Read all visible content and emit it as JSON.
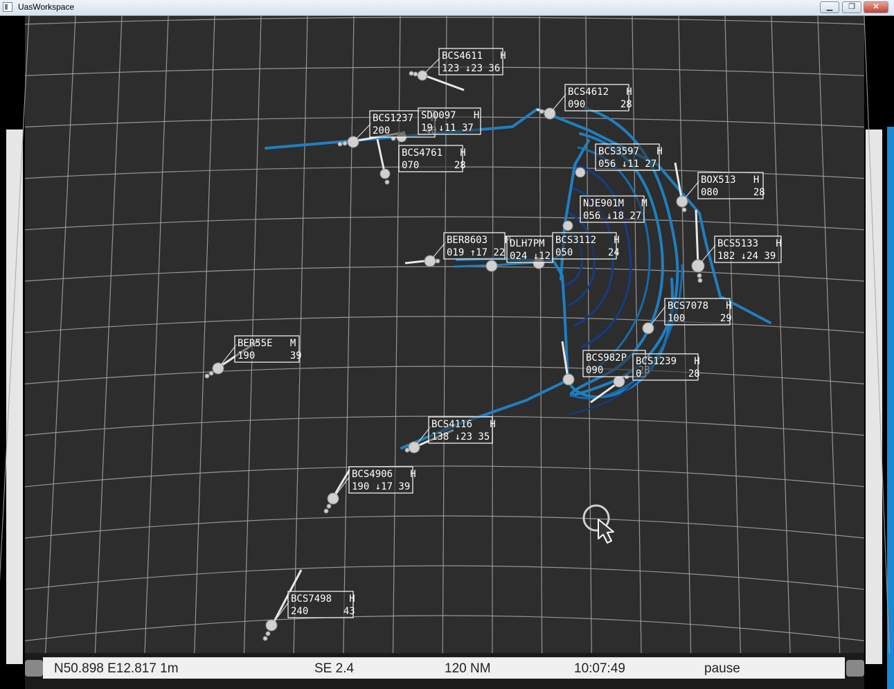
{
  "window": {
    "title": "UasWorkspace",
    "minimize_label": "▁",
    "restore_label": "❐",
    "close_label": "✕"
  },
  "status": {
    "position": "N50.898  E12.817  1m",
    "wind": "SE 2.4",
    "range": "120 NM",
    "time": "10:07:49",
    "mode": "pause"
  },
  "colors": {
    "background": "#2d2d2d",
    "grid": "#a8a8a8",
    "route_light": "#1f7fbf",
    "route_dark": "#143c86",
    "label_border": "#ffffff"
  },
  "icons": [
    "cursor-arrow-icon",
    "minimize-icon",
    "restore-icon",
    "close-icon"
  ],
  "aircraft": [
    {
      "id": "bcs4611",
      "line1": "BCS4611   H",
      "line2": "123 ↓23 36"
    },
    {
      "id": "bcs4612",
      "line1": "BCS4612   H",
      "line2": "090      28"
    },
    {
      "id": "bcs1237",
      "line1": "BCS1237   H",
      "line2": "200      40"
    },
    {
      "id": "sdo097",
      "line1": "SDO097   H",
      "line2": "19 ↓11 37"
    },
    {
      "id": "bcs4761",
      "line1": "BCS4761   H",
      "line2": "070      28"
    },
    {
      "id": "bcs3597",
      "line1": "BCS3597   H",
      "line2": "056 ↓11 27"
    },
    {
      "id": "box513",
      "line1": "BOX513   H",
      "line2": "080      28"
    },
    {
      "id": "nje901m",
      "line1": "NJE901M   M",
      "line2": "056 ↓18 27"
    },
    {
      "id": "ber8603",
      "line1": "BER8603   M",
      "line2": "019 ↑17 22"
    },
    {
      "id": "dlh7pm",
      "line1": "DLH7PM",
      "line2": "024 ↓12"
    },
    {
      "id": "bcs3112",
      "line1": "BCS3112   H",
      "line2": "050      24"
    },
    {
      "id": "bcs5133",
      "line1": "BCS5133   H",
      "line2": "182 ↓24 39"
    },
    {
      "id": "bcs7078",
      "line1": "BCS7078   H",
      "line2": "100      29"
    },
    {
      "id": "ber55e",
      "line1": "BER55E   M",
      "line2": "190      39"
    },
    {
      "id": "bcs982p",
      "line1": "BCS982P   H",
      "line2": "090      28"
    },
    {
      "id": "bcs1239",
      "line1": "BCS1239   H",
      "line2": "0        28"
    },
    {
      "id": "bcs4116",
      "line1": "BCS4116   H",
      "line2": "138 ↓23 35"
    },
    {
      "id": "bcs4906",
      "line1": "BCS4906   H",
      "line2": "190 ↓17 39"
    },
    {
      "id": "bcs7498",
      "line1": "BCS7498   H",
      "line2": "240      43"
    }
  ]
}
